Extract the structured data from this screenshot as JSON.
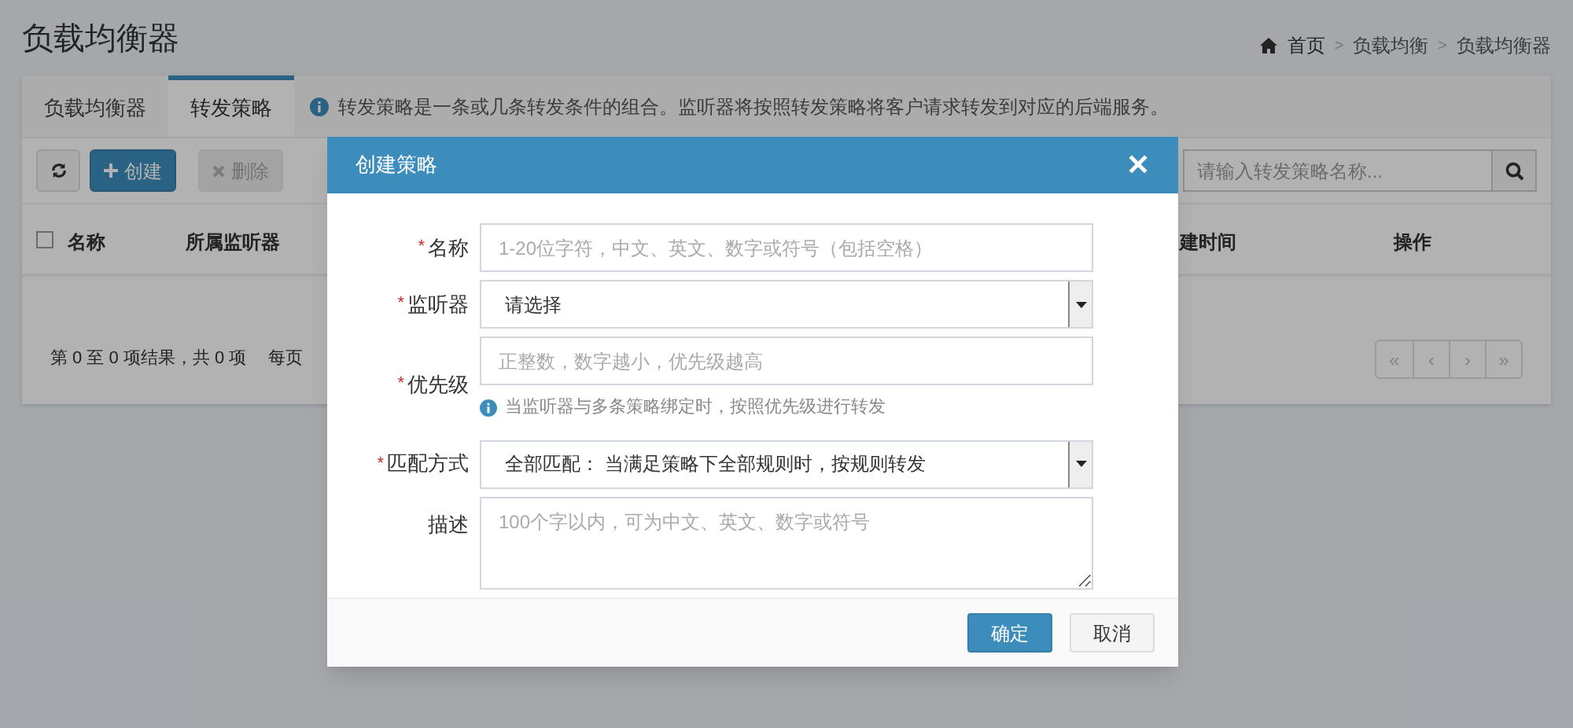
{
  "page": {
    "title": "负载均衡器",
    "breadcrumb": [
      "首页",
      "负载均衡",
      "负载均衡器"
    ],
    "breadcrumb_separator": ">"
  },
  "tabs": [
    {
      "label": "负载均衡器",
      "selected": false
    },
    {
      "label": "转发策略",
      "selected": true
    }
  ],
  "info": "转发策略是一条或几条转发条件的组合。监听器将按照转发策略将客户请求转发到对应的后端服务。",
  "toolbar": {
    "buttons": [
      {
        "kind": "refresh",
        "disabled": false
      },
      {
        "kind": "create",
        "label": "创建",
        "disabled": false
      },
      {
        "kind": "delete",
        "label": "删除",
        "disabled": true
      }
    ],
    "search_placeholder": "请输入转发策略名称..."
  },
  "table": {
    "select_all_checked": false,
    "columns": [
      {
        "label": "名称"
      },
      {
        "label": "所属监听器"
      },
      {
        "label": "建时间"
      },
      {
        "label": "操作"
      }
    ]
  },
  "footer": {
    "summary": "第 0 至 0 项结果，共 0 项",
    "page_size_label": "每页",
    "pager": [
      "«",
      "‹",
      "›",
      "»"
    ]
  },
  "modal": {
    "title": "创建策略",
    "close": "✕",
    "required_mark": "*",
    "fields": [
      {
        "kind": "input",
        "label": "名称",
        "required": true,
        "placeholder": "1-20位字符，中文、英文、数字或符号（包括空格）"
      },
      {
        "kind": "select",
        "label": "监听器",
        "required": true,
        "value": "请选择"
      },
      {
        "kind": "input",
        "label": "优先级",
        "required": true,
        "placeholder": "正整数，数字越小，优先级越高",
        "hint": "当监听器与多条策略绑定时，按照优先级进行转发"
      },
      {
        "kind": "select",
        "label": "匹配方式",
        "required": true,
        "value": "全部匹配： 当满足策略下全部规则时，按规则转发"
      },
      {
        "kind": "textarea",
        "label": "描述",
        "required": false,
        "placeholder": "100个字以内，可为中文、英文、数字或符号"
      }
    ],
    "buttons": [
      {
        "kind": "primary",
        "label": "确定"
      },
      {
        "kind": "default",
        "label": "取消"
      }
    ]
  }
}
